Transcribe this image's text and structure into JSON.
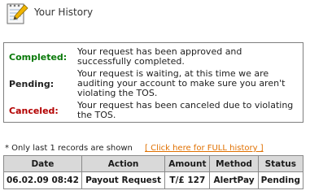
{
  "header": {
    "title": "Your History",
    "icon": "notepad-pencil-icon"
  },
  "legend": [
    {
      "label": "Completed:",
      "color": "#0a7a0a",
      "lines": [
        "Your request has been approved and",
        "successfully completed."
      ]
    },
    {
      "label": "Pending:",
      "color": "#222222",
      "lines": [
        "Your request is waiting, at this time we are",
        "auditing your account to make sure you aren't",
        "violating the TOS."
      ]
    },
    {
      "label": "Canceled:",
      "color": "#b30000",
      "lines": [
        "Your request has been canceled due to violating",
        "the TOS."
      ]
    }
  ],
  "note": "* Only last 1 records are shown",
  "full_history_link": "[ Click here for FULL history ]",
  "table": {
    "headers": [
      "Date",
      "Action",
      "Amount",
      "Method",
      "Status"
    ],
    "rows": [
      [
        "06.02.09 08:42",
        "Payout Request",
        "T/£ 127",
        "AlertPay",
        "Pending"
      ]
    ]
  }
}
